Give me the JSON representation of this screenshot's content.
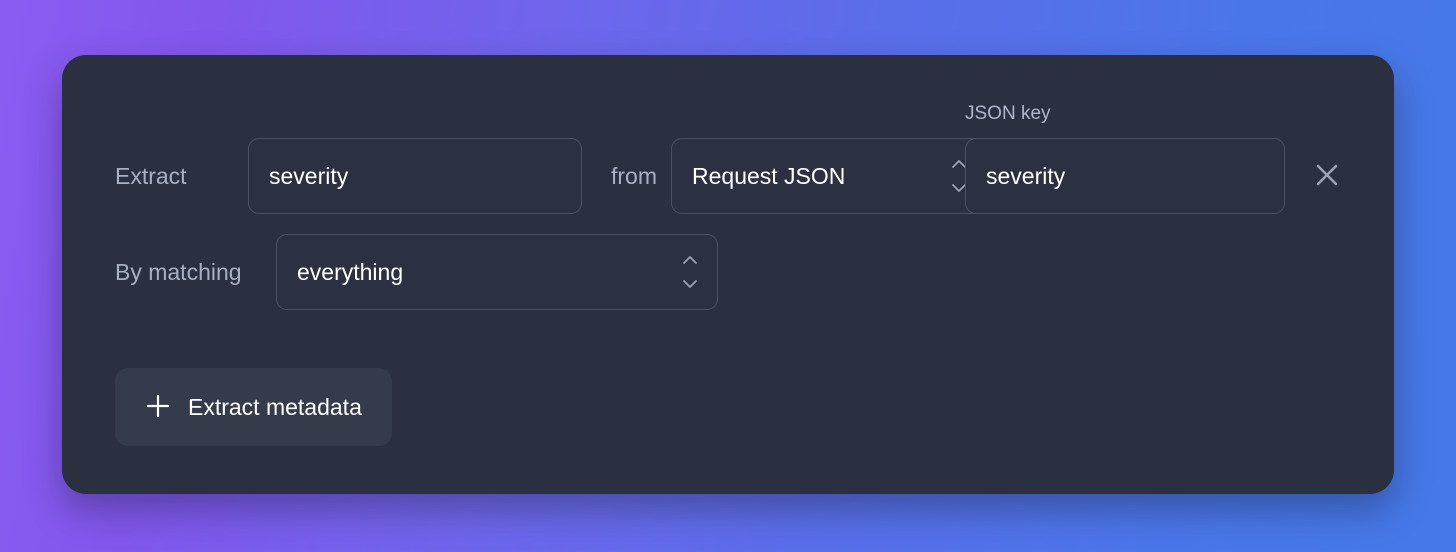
{
  "theme": {
    "gradient_start": "#8b5cf2",
    "gradient_end": "#4579e8",
    "card_bg": "#2a3040",
    "field_bg": "#2b3141",
    "field_border": "#4b5266",
    "button_bg": "#343b4b",
    "text_primary": "#ffffff",
    "text_muted": "#a8b0c4",
    "icon_color": "#9aa3b8"
  },
  "extract_rule": {
    "extract_label": "Extract",
    "name_value": "severity",
    "name_placeholder": "severity",
    "from_label": "from",
    "source_value": "Request JSON",
    "source_options": [
      "Request JSON"
    ],
    "json_key_caption": "JSON key",
    "json_key_value": "severity",
    "json_key_placeholder": "severity",
    "remove_label": "",
    "remove_icon": "close-icon",
    "matching_label": "By matching",
    "matching_value": "everything",
    "matching_options": [
      "everything"
    ],
    "stepper_icon": "chevron-up-down-icon"
  },
  "actions": {
    "add_label": "Extract metadata",
    "add_icon": "plus-icon"
  }
}
